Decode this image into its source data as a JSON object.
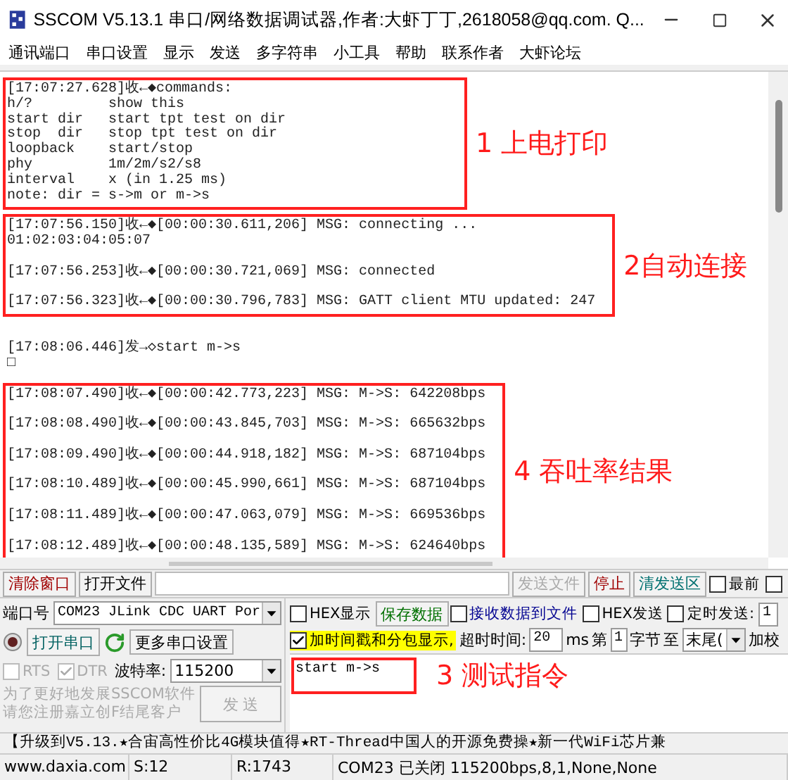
{
  "window": {
    "title": "SSCOM V5.13.1 串口/网络数据调试器,作者:大虾丁丁,2618058@qq.com. Q..."
  },
  "menu": [
    "通讯端口",
    "串口设置",
    "显示",
    "发送",
    "多字符串",
    "小工具",
    "帮助",
    "联系作者",
    "大虾论坛"
  ],
  "log": {
    "groups": [
      {
        "boxed": true,
        "note": "1 上电打印",
        "lines": [
          {
            "text": "[17:07:27.628]收←◆commands:",
            "gap_before": false
          },
          {
            "text": "h/?         show this",
            "gap_before": false
          },
          {
            "text": "start dir   start tpt test on dir",
            "gap_before": false
          },
          {
            "text": "stop  dir   stop tpt test on dir",
            "gap_before": false
          },
          {
            "text": "loopback    start/stop",
            "gap_before": false
          },
          {
            "text": "phy         1m/2m/s2/s8",
            "gap_before": false
          },
          {
            "text": "interval    x (in 1.25 ms)",
            "gap_before": false
          },
          {
            "text": "note: dir = s->m or m->s",
            "gap_before": false
          }
        ]
      },
      {
        "boxed": true,
        "note": "2自动连接",
        "lines": [
          {
            "text": "[17:07:56.150]收←◆[00:00:30.611,206] MSG: connecting ...",
            "gap_before": false
          },
          {
            "text": "01:02:03:04:05:07",
            "gap_before": false
          },
          {
            "text": "[17:07:56.253]收←◆[00:00:30.721,069] MSG: connected",
            "gap_before": true
          },
          {
            "text": "[17:07:56.323]收←◆[00:00:30.796,783] MSG: GATT client MTU updated: 247",
            "gap_before": true
          }
        ]
      },
      {
        "boxed": false,
        "lines": [
          {
            "text": "[17:08:06.446]发→◇start m->s",
            "gap_before": true
          },
          {
            "text": "□",
            "gap_before": false
          }
        ]
      },
      {
        "boxed": true,
        "note": "4 吞吐率结果",
        "lines": [
          {
            "text": "[17:08:07.490]收←◆[00:00:42.773,223] MSG: M->S: 642208bps",
            "gap_before": false
          },
          {
            "text": "[17:08:08.490]收←◆[00:00:43.845,703] MSG: M->S: 665632bps",
            "gap_before": true
          },
          {
            "text": "[17:08:09.490]收←◆[00:00:44.918,182] MSG: M->S: 687104bps",
            "gap_before": true
          },
          {
            "text": "[17:08:10.489]收←◆[00:00:45.990,661] MSG: M->S: 687104bps",
            "gap_before": true
          },
          {
            "text": "[17:08:11.489]收←◆[00:00:47.063,079] MSG: M->S: 669536bps",
            "gap_before": true
          },
          {
            "text": "[17:08:12.489]收←◆[00:00:48.135,589] MSG: M->S: 624640bps",
            "gap_before": true
          }
        ]
      }
    ]
  },
  "top_row": {
    "clear_window": "清除窗口",
    "open_file": "打开文件",
    "send_file": {
      "label": "发送文件",
      "disabled": true
    },
    "stop": "停止",
    "clear_send": "清发送区",
    "topmost": {
      "label": "最前",
      "checked": false
    },
    "extra": {
      "checked": false
    }
  },
  "port": {
    "label": "端口号",
    "value": "COM23 JLink CDC UART Por",
    "open": false,
    "open_button": "打开串口",
    "more_settings": "更多串口设置"
  },
  "rts": {
    "label": "RTS",
    "checked": false,
    "disabled": true
  },
  "dtr": {
    "label": "DTR",
    "checked": true,
    "disabled": true
  },
  "baud": {
    "label": "波特率:",
    "value": "115200"
  },
  "promo": [
    "为了更好地发展SSCOM软件",
    "请您注册嘉立创F结尾客户"
  ],
  "send_button": {
    "label": "发 送",
    "disabled": true
  },
  "hex_display": {
    "label": "HEX显示",
    "checked": false
  },
  "save_data": "保存数据",
  "receive_to_file": {
    "label": "接收数据到文件",
    "checked": false
  },
  "hex_send": {
    "label": "HEX发送",
    "checked": false
  },
  "timed_send": {
    "label": "定时发送:",
    "checked": false,
    "value": "1"
  },
  "timestamp": {
    "label": "加时间戳和分包显示,",
    "checked": true
  },
  "timeout": {
    "label": "超时时间:",
    "value": "20",
    "unit": "ms"
  },
  "checksum": {
    "prefix": "第",
    "from": "1",
    "unit": "字节",
    "to": "至",
    "end": "末尾(",
    "label": "加校"
  },
  "send_input": {
    "value": "start m->s",
    "note": "3 测试指令"
  },
  "ticker": "【升级到V5.13.★合宙高性价比4G模块值得★RT-Thread中国人的开源免费操★新一代WiFi芯片兼",
  "status_bar": [
    "www.daxia.com",
    "S:12",
    "R:1743",
    "COM23 已关闭  115200bps,8,1,None,None"
  ]
}
